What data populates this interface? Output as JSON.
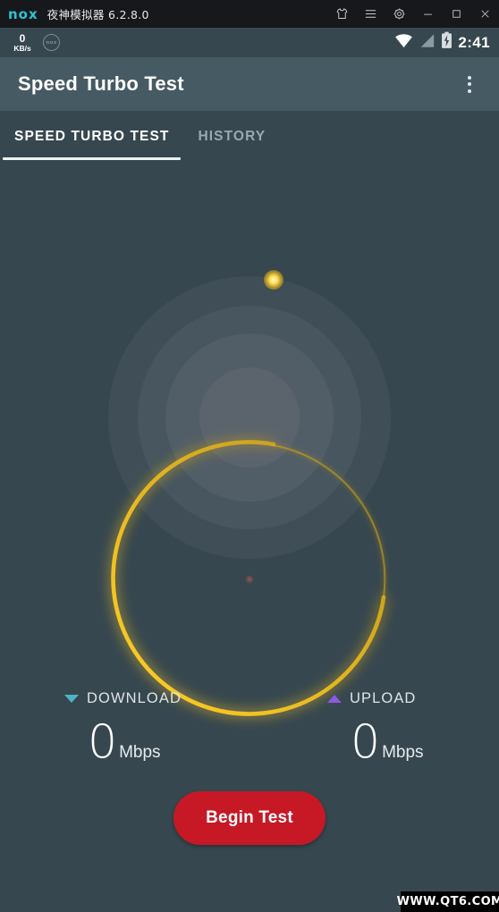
{
  "emulator": {
    "logo_text": "nox",
    "title": "夜神模拟器 6.2.8.0",
    "buttons": [
      {
        "name": "skin-shirt-icon",
        "label": "Theme"
      },
      {
        "name": "menu-icon",
        "label": "Menu"
      },
      {
        "name": "gear-icon",
        "label": "Settings"
      },
      {
        "name": "minimize-icon",
        "label": "Minimize"
      },
      {
        "name": "maximize-icon",
        "label": "Maximize"
      },
      {
        "name": "close-icon",
        "label": "Close"
      }
    ]
  },
  "statusbar": {
    "net_speed_value": "0",
    "net_speed_unit": "KB/s",
    "nox_badge_text": "nox",
    "wifi_icon": "wifi-icon",
    "signal_icon": "signal-icon",
    "battery_icon": "battery-charging-icon",
    "clock": "2:41"
  },
  "appbar": {
    "title": "Speed Turbo Test",
    "overflow_label": "More options"
  },
  "tabs": [
    {
      "label": "SPEED TURBO TEST",
      "active": true
    },
    {
      "label": "HISTORY",
      "active": false
    }
  ],
  "gauge": {
    "arc_color": "#e8b51d",
    "arc_glow_color": "#ffd24a",
    "ring_count": 4,
    "center_dot_color": "#b0564e"
  },
  "readouts": {
    "download": {
      "label": "DOWNLOAD",
      "value": "0",
      "unit": "Mbps",
      "arrow": "triangle-down-icon",
      "arrow_color": "#4fb3c6"
    },
    "upload": {
      "label": "UPLOAD",
      "value": "0",
      "unit": "Mbps",
      "arrow": "triangle-up-icon",
      "arrow_color": "#8c5ae0"
    }
  },
  "begin_button": {
    "label": "Begin Test",
    "color": "#c61825"
  },
  "watermark": {
    "text": "WWW.QT6.COM"
  },
  "colors": {
    "page_bg": "#37474f",
    "appbar_bg": "#465a63",
    "titlebar_bg": "#16181c",
    "accent_teal": "#29c5d6"
  }
}
